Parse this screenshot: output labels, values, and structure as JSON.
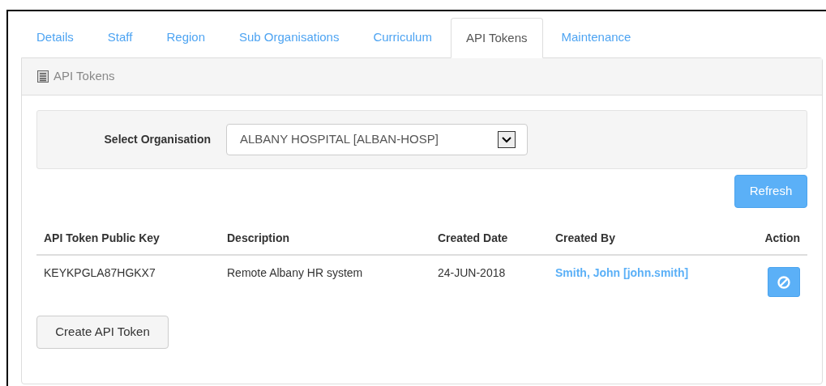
{
  "tabs": [
    {
      "label": "Details",
      "selected": false
    },
    {
      "label": "Staff",
      "selected": false
    },
    {
      "label": "Region",
      "selected": false
    },
    {
      "label": "Sub Organisations",
      "selected": false
    },
    {
      "label": "Curriculum",
      "selected": false
    },
    {
      "label": "API Tokens",
      "selected": true
    },
    {
      "label": "Maintenance",
      "selected": false
    }
  ],
  "panel": {
    "title": "API Tokens"
  },
  "filter": {
    "label": "Select Organisation",
    "value": "ALBANY HOSPITAL [ALBAN-HOSP]"
  },
  "refresh_button": "Refresh",
  "table": {
    "columns": [
      "API Token Public Key",
      "Description",
      "Created Date",
      "Created By",
      "Action"
    ],
    "rows": [
      {
        "key": "KEYKPGLA87HGKX7",
        "description": "Remote Albany HR system",
        "created_date": "24-JUN-2018",
        "created_by": "Smith, John [john.smith]"
      }
    ]
  },
  "create_button": "Create API Token"
}
